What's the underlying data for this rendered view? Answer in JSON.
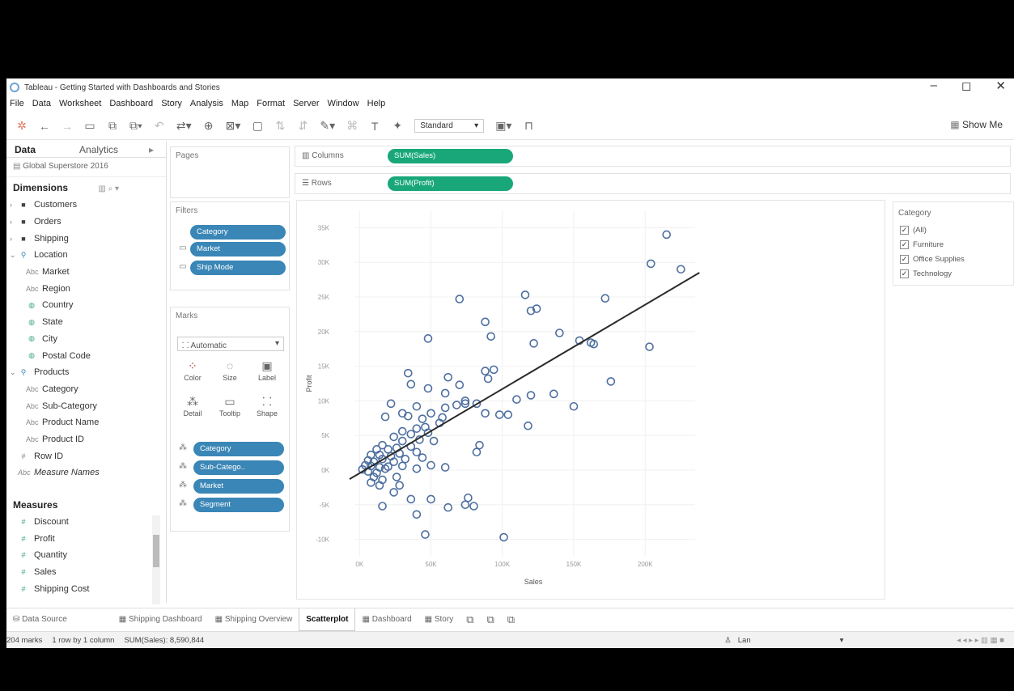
{
  "window": {
    "title": "Tableau - Getting Started with Dashboards and Stories",
    "controls": [
      "–",
      "◻",
      "✕"
    ]
  },
  "menu": [
    "File",
    "Data",
    "Worksheet",
    "Dashboard",
    "Story",
    "Analysis",
    "Map",
    "Format",
    "Server",
    "Window",
    "Help"
  ],
  "toolbar": {
    "fit": "Standard",
    "show_me": "Show Me"
  },
  "data_pane": {
    "tab_data": "Data",
    "tab_analytics": "Analytics",
    "source": "Global Superstore 2016",
    "dimensions_label": "Dimensions",
    "dimensions": [
      {
        "label": "Customers",
        "icon": "folder-icon",
        "level": 0,
        "arrow": "›"
      },
      {
        "label": "Orders",
        "icon": "folder-icon",
        "level": 0,
        "arrow": "›"
      },
      {
        "label": "Shipping",
        "icon": "folder-icon",
        "level": 0,
        "arrow": "›"
      },
      {
        "label": "Location",
        "icon": "hierarchy-icon",
        "level": 0,
        "arrow": "⌄"
      },
      {
        "label": "Market",
        "icon": "abc-icon",
        "level": 1
      },
      {
        "label": "Region",
        "icon": "abc-icon",
        "level": 1
      },
      {
        "label": "Country",
        "icon": "globe-icon",
        "level": 1
      },
      {
        "label": "State",
        "icon": "globe-icon",
        "level": 1
      },
      {
        "label": "City",
        "icon": "globe-icon",
        "level": 1
      },
      {
        "label": "Postal Code",
        "icon": "globe-icon",
        "level": 1
      },
      {
        "label": "Products",
        "icon": "hierarchy-icon",
        "level": 0,
        "arrow": "⌄"
      },
      {
        "label": "Category",
        "icon": "abc-icon",
        "level": 1
      },
      {
        "label": "Sub-Category",
        "icon": "abc-icon",
        "level": 1
      },
      {
        "label": "Product Name",
        "icon": "abc-icon",
        "level": 1
      },
      {
        "label": "Product ID",
        "icon": "abc-icon",
        "level": 1
      },
      {
        "label": "Row ID",
        "icon": "number-icon",
        "level": 0
      },
      {
        "label": "Measure Names",
        "icon": "abc-icon",
        "level": 0,
        "italic": true
      }
    ],
    "measures_label": "Measures",
    "measures": [
      "Discount",
      "Profit",
      "Quantity",
      "Sales",
      "Shipping Cost"
    ]
  },
  "pages_label": "Pages",
  "filters": {
    "label": "Filters",
    "pills": [
      "Category",
      "Market",
      "Ship Mode"
    ]
  },
  "marks": {
    "label": "Marks",
    "type": "Automatic",
    "buttons": [
      {
        "label": "Color",
        "icon": "color-icon"
      },
      {
        "label": "Size",
        "icon": "size-icon"
      },
      {
        "label": "Label",
        "icon": "label-icon"
      },
      {
        "label": "Detail",
        "icon": "detail-icon"
      },
      {
        "label": "Tooltip",
        "icon": "tooltip-icon"
      },
      {
        "label": "Shape",
        "icon": "shape-icon"
      }
    ],
    "pills": [
      "Category",
      "Sub-Catego..",
      "Market",
      "Segment"
    ]
  },
  "shelves": {
    "columns_label": "Columns",
    "columns_pill": "SUM(Sales)",
    "rows_label": "Rows",
    "rows_pill": "SUM(Profit)"
  },
  "legend": {
    "title": "Category",
    "items": [
      "(All)",
      "Furniture",
      "Office Supplies",
      "Technology"
    ]
  },
  "chart_data": {
    "type": "scatter",
    "xlabel": "Sales",
    "ylabel": "Profit",
    "xlim": [
      -3000,
      235000
    ],
    "ylim": [
      -12500,
      37500
    ],
    "x_ticks": [
      "0K",
      "50K",
      "100K",
      "150K",
      "200K"
    ],
    "x_tick_values": [
      0,
      50000,
      100000,
      150000,
      200000
    ],
    "y_ticks": [
      "35K",
      "30K",
      "25K",
      "20K",
      "15K",
      "10K",
      "5K",
      "0K",
      "-5K",
      "-10K"
    ],
    "y_tick_values": [
      35000,
      30000,
      25000,
      20000,
      15000,
      10000,
      5000,
      0,
      -5000,
      -10000
    ],
    "trend_line": [
      [
        -7000,
        -1300
      ],
      [
        238000,
        28500
      ]
    ],
    "marker_color": "#4e6fa0",
    "points": [
      [
        215000,
        34000
      ],
      [
        204000,
        29800
      ],
      [
        225000,
        29000
      ],
      [
        116000,
        25300
      ],
      [
        70000,
        24700
      ],
      [
        172000,
        24800
      ],
      [
        120000,
        23000
      ],
      [
        124000,
        23300
      ],
      [
        88000,
        21400
      ],
      [
        48000,
        19000
      ],
      [
        92000,
        19300
      ],
      [
        140000,
        19800
      ],
      [
        122000,
        18300
      ],
      [
        154000,
        18700
      ],
      [
        162000,
        18400
      ],
      [
        164000,
        18200
      ],
      [
        203000,
        17800
      ],
      [
        88000,
        14300
      ],
      [
        94000,
        14500
      ],
      [
        34000,
        14000
      ],
      [
        90000,
        13200
      ],
      [
        62000,
        13400
      ],
      [
        36000,
        12400
      ],
      [
        70000,
        12300
      ],
      [
        176000,
        12800
      ],
      [
        48000,
        11800
      ],
      [
        120000,
        10800
      ],
      [
        136000,
        11000
      ],
      [
        60000,
        11100
      ],
      [
        110000,
        10200
      ],
      [
        74000,
        10000
      ],
      [
        22000,
        9600
      ],
      [
        40000,
        9200
      ],
      [
        60000,
        9000
      ],
      [
        74000,
        9600
      ],
      [
        82000,
        9600
      ],
      [
        68000,
        9400
      ],
      [
        150000,
        9200
      ],
      [
        88000,
        8200
      ],
      [
        98000,
        8000
      ],
      [
        104000,
        8000
      ],
      [
        50000,
        8200
      ],
      [
        30000,
        8200
      ],
      [
        18000,
        7700
      ],
      [
        34000,
        7800
      ],
      [
        44000,
        7400
      ],
      [
        58000,
        7600
      ],
      [
        118000,
        6400
      ],
      [
        46000,
        6200
      ],
      [
        56000,
        6800
      ],
      [
        40000,
        6000
      ],
      [
        30000,
        5600
      ],
      [
        36000,
        5200
      ],
      [
        48000,
        5400
      ],
      [
        24000,
        4800
      ],
      [
        30000,
        4200
      ],
      [
        42000,
        4400
      ],
      [
        52000,
        4200
      ],
      [
        16000,
        3600
      ],
      [
        26000,
        3200
      ],
      [
        36000,
        3400
      ],
      [
        84000,
        3600
      ],
      [
        82000,
        2600
      ],
      [
        12000,
        3000
      ],
      [
        20000,
        3000
      ],
      [
        28000,
        2400
      ],
      [
        40000,
        2600
      ],
      [
        8000,
        2200
      ],
      [
        14000,
        2200
      ],
      [
        22000,
        2000
      ],
      [
        32000,
        1600
      ],
      [
        44000,
        1800
      ],
      [
        6000,
        1400
      ],
      [
        10000,
        1200
      ],
      [
        16000,
        1600
      ],
      [
        24000,
        1200
      ],
      [
        50000,
        700
      ],
      [
        4000,
        700
      ],
      [
        8000,
        600
      ],
      [
        14000,
        400
      ],
      [
        20000,
        500
      ],
      [
        30000,
        600
      ],
      [
        60000,
        400
      ],
      [
        2000,
        100
      ],
      [
        6000,
        -200
      ],
      [
        12000,
        -400
      ],
      [
        18000,
        200
      ],
      [
        40000,
        200
      ],
      [
        10000,
        -1000
      ],
      [
        16000,
        -1400
      ],
      [
        26000,
        -1000
      ],
      [
        8000,
        -1800
      ],
      [
        14000,
        -2200
      ],
      [
        28000,
        -2200
      ],
      [
        24000,
        -3200
      ],
      [
        36000,
        -4200
      ],
      [
        50000,
        -4200
      ],
      [
        76000,
        -4000
      ],
      [
        62000,
        -5400
      ],
      [
        74000,
        -5000
      ],
      [
        80000,
        -5200
      ],
      [
        16000,
        -5200
      ],
      [
        40000,
        -6400
      ],
      [
        46000,
        -9300
      ],
      [
        101000,
        -9700
      ]
    ]
  },
  "tabs": {
    "datasource": "Data Source",
    "sheets": [
      "Shipping Dashboard",
      "Shipping Overview",
      "Scatterplot",
      "Dashboard",
      "Story"
    ],
    "active": "Scatterplot"
  },
  "status": {
    "marks": "204 marks",
    "dims": "1 row by 1 column",
    "sum": "SUM(Sales): 8,590,844",
    "user": "Lan"
  }
}
